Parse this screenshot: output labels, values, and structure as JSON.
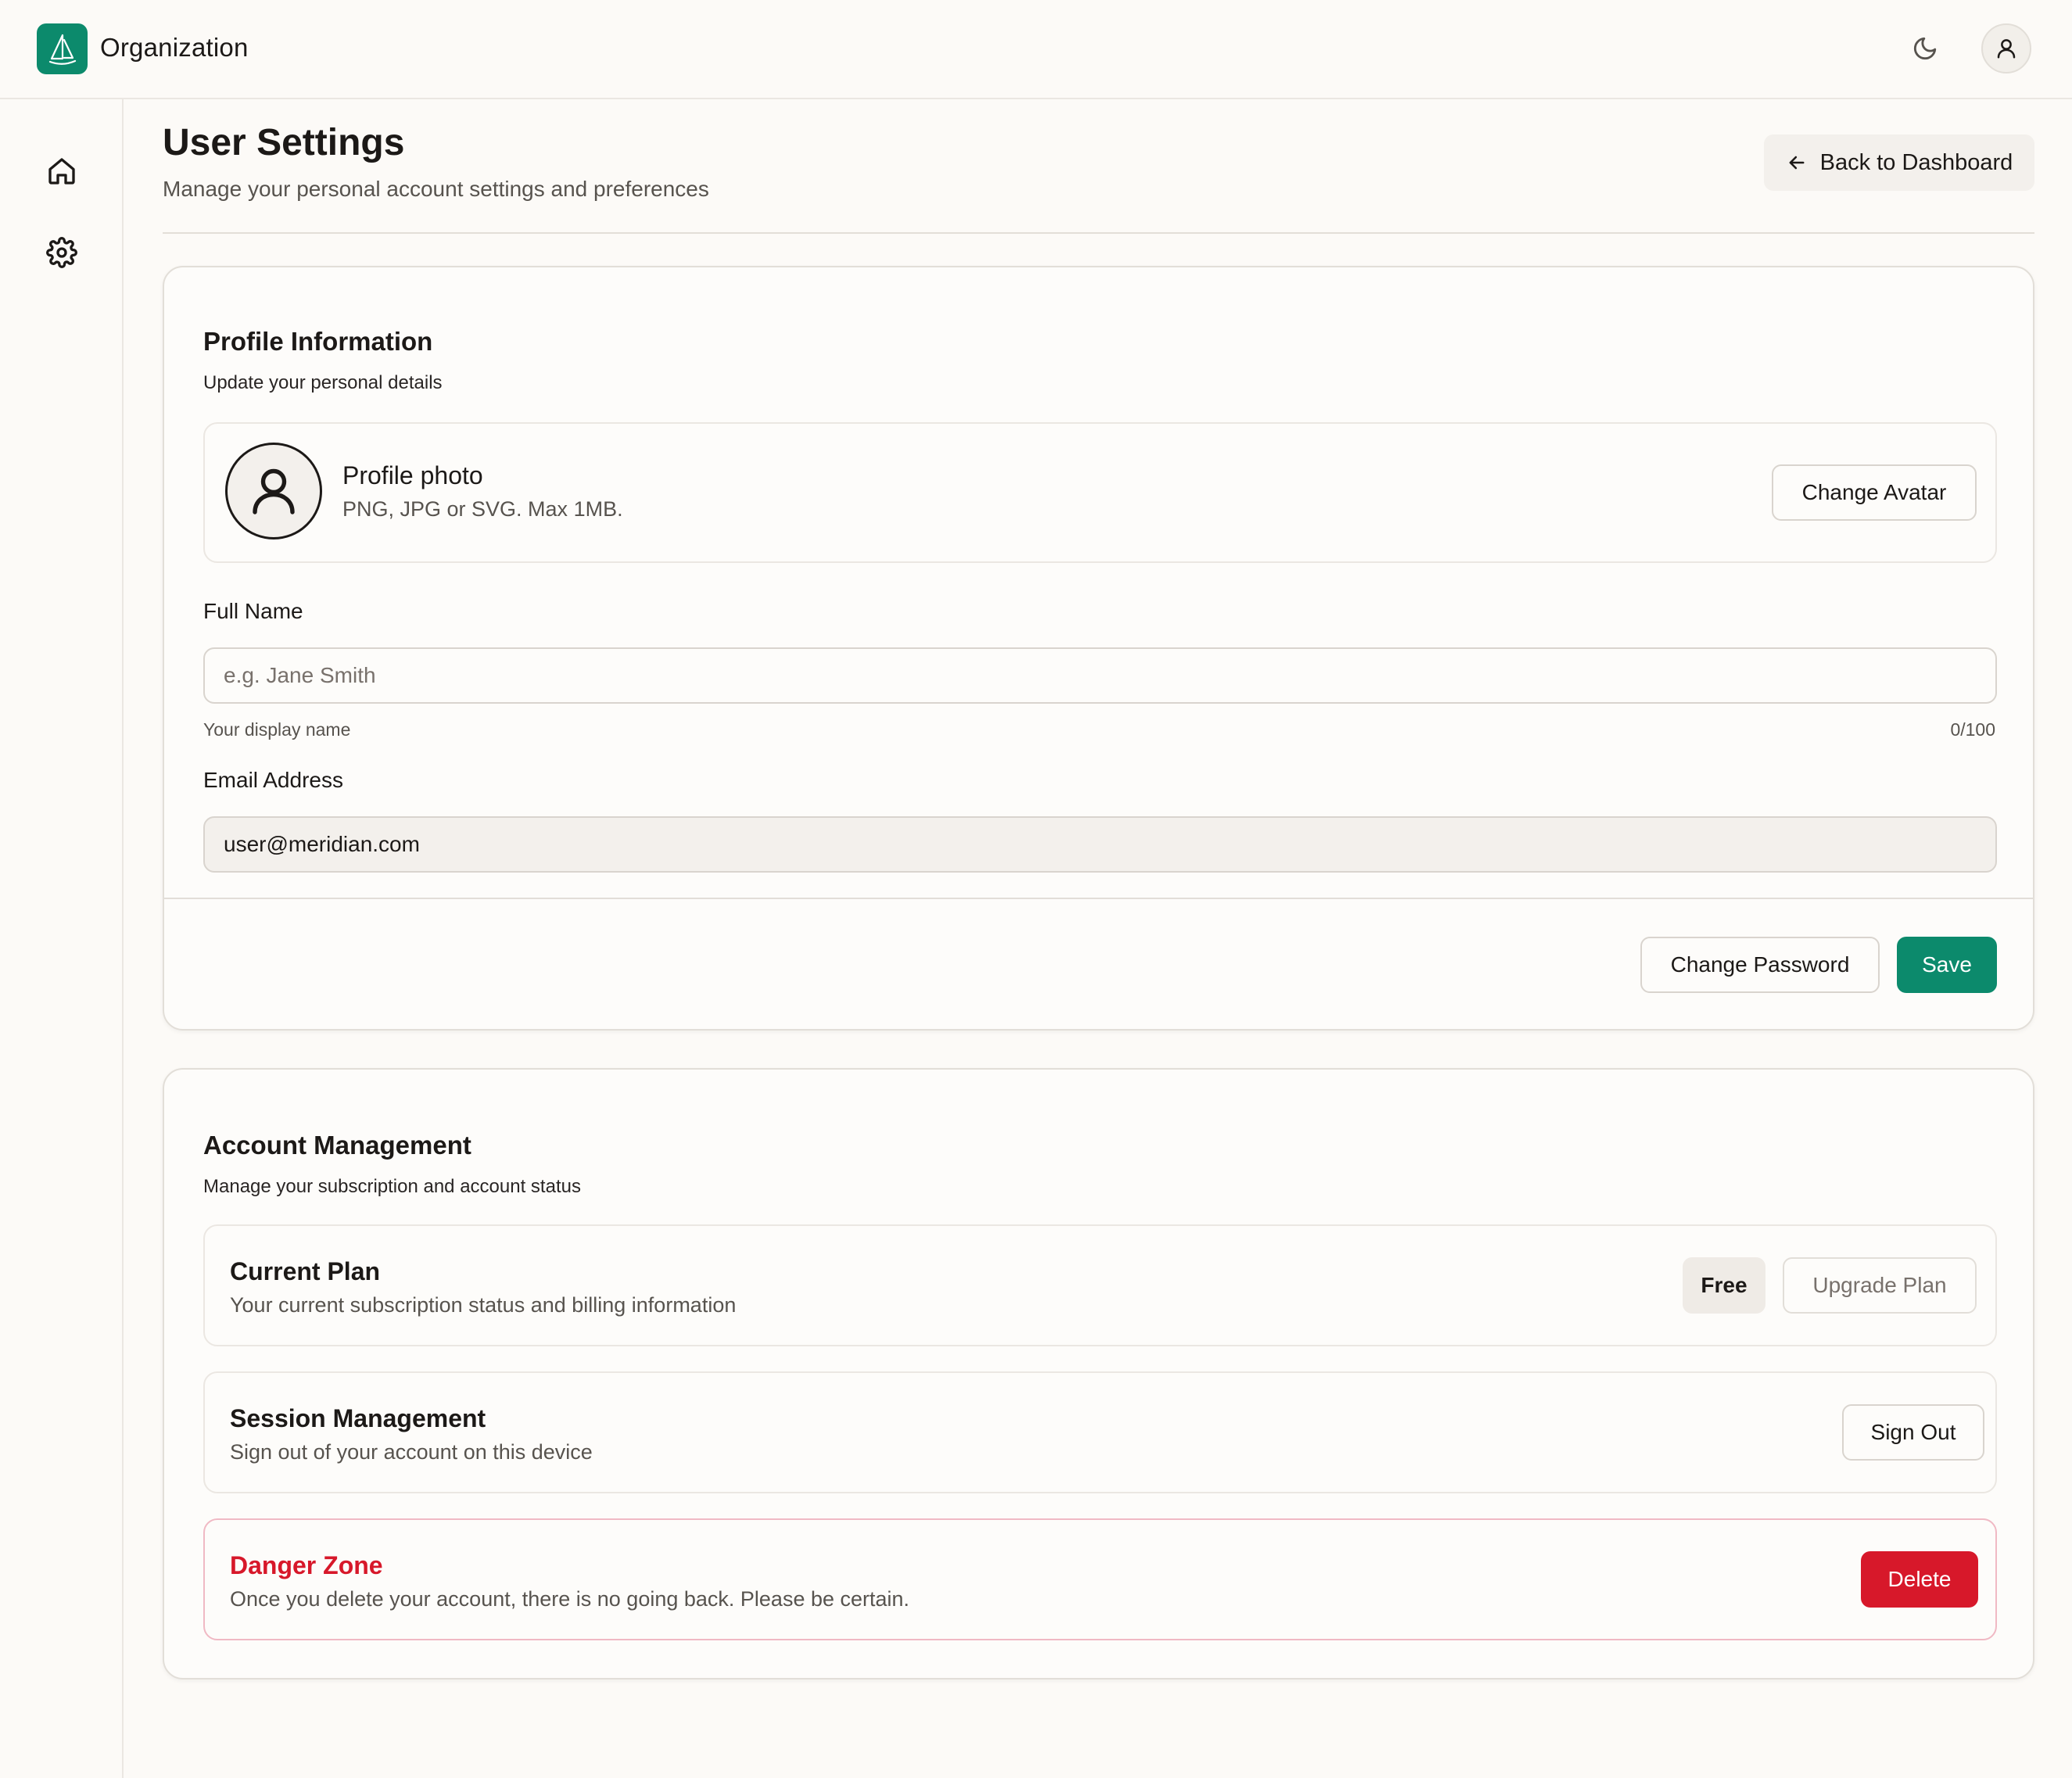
{
  "app": {
    "org_name": "Organization"
  },
  "header": {
    "title": "User Settings",
    "subtitle": "Manage your personal account settings and preferences",
    "back_label": "Back to Dashboard"
  },
  "sidebar": {
    "items": [
      "home-icon",
      "gear-icon"
    ]
  },
  "profile": {
    "title": "Profile Information",
    "subtitle": "Update your personal details",
    "photo_label": "Profile photo",
    "photo_hint": "PNG, JPG or SVG. Max 1MB.",
    "change_avatar": "Change Avatar",
    "full_name_label": "Full Name",
    "full_name_placeholder": "e.g. Jane Smith",
    "full_name_value": "",
    "full_name_hint": "Your display name",
    "full_name_count": "0/100",
    "email_label": "Email Address",
    "email_value": "user@meridian.com",
    "change_password": "Change Password",
    "save": "Save"
  },
  "account": {
    "title": "Account Management",
    "subtitle": "Manage your subscription and account status",
    "plan_title": "Current Plan",
    "plan_sub": "Your current subscription status and billing information",
    "plan_badge": "Free",
    "upgrade": "Upgrade Plan",
    "session_title": "Session Management",
    "session_sub": "Sign out of your account on this device",
    "sign_out": "Sign Out",
    "danger_title": "Danger Zone",
    "danger_sub": "Once you delete your account, there is no going back. Please be certain.",
    "delete": "Delete"
  },
  "colors": {
    "brand": "#0c8a6c",
    "danger": "#d7182a",
    "background": "#fcfaf7"
  }
}
